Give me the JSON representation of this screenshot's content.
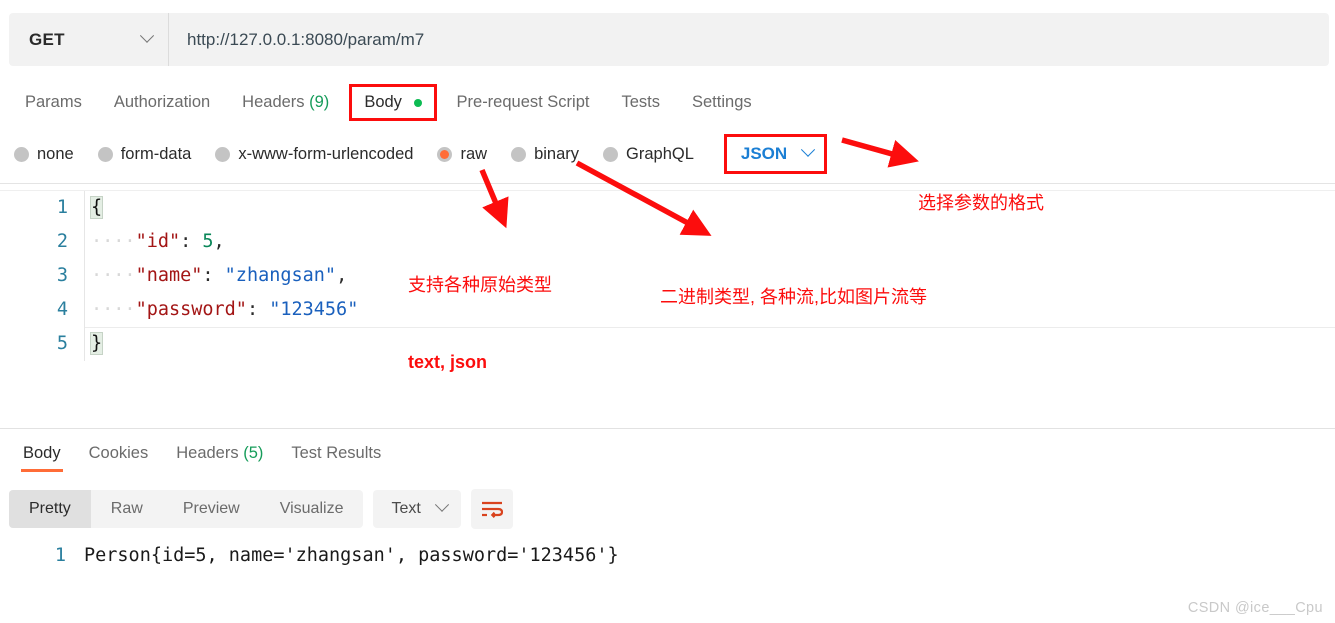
{
  "request": {
    "method": "GET",
    "url": "http://127.0.0.1:8080/param/m7",
    "tabs": [
      {
        "label": "Params"
      },
      {
        "label": "Authorization"
      },
      {
        "label": "Headers",
        "count": "(9)"
      },
      {
        "label": "Body",
        "dot": true,
        "active": true,
        "boxed": true
      },
      {
        "label": "Pre-request Script"
      },
      {
        "label": "Tests"
      },
      {
        "label": "Settings"
      }
    ],
    "body_types": [
      {
        "label": "none",
        "selected": false
      },
      {
        "label": "form-data",
        "selected": false
      },
      {
        "label": "x-www-form-urlencoded",
        "selected": false
      },
      {
        "label": "raw",
        "selected": true
      },
      {
        "label": "binary",
        "selected": false
      },
      {
        "label": "GraphQL",
        "selected": false
      }
    ],
    "format_select": {
      "value": "JSON",
      "icon": "chevron-down-icon"
    }
  },
  "editor": {
    "lines": [
      {
        "num": "1",
        "open_brace": "{"
      },
      {
        "num": "2",
        "indent": "····",
        "key": "\"id\"",
        "colon": ":",
        "space": " ",
        "num_value": "5",
        "comma": ","
      },
      {
        "num": "3",
        "indent": "····",
        "key": "\"name\"",
        "colon": ":",
        "space": " ",
        "str_value": "\"zhangsan\"",
        "comma": ","
      },
      {
        "num": "4",
        "indent": "····",
        "key": "\"password\"",
        "colon": ":",
        "space": " ",
        "str_value": "\"123456\""
      },
      {
        "num": "5",
        "close_brace": "}"
      }
    ]
  },
  "annotations": [
    {
      "id": "raw-note",
      "line1": "支持各种原始类型",
      "line2": "text, json"
    },
    {
      "id": "binary-note",
      "line1": "二进制类型, 各种流,比如图片流等"
    },
    {
      "id": "format-note",
      "line1": "选择参数的格式"
    }
  ],
  "response": {
    "tabs": [
      {
        "label": "Body",
        "active": true
      },
      {
        "label": "Cookies"
      },
      {
        "label": "Headers",
        "count": "(5)"
      },
      {
        "label": "Test Results"
      }
    ],
    "view_modes": [
      {
        "label": "Pretty",
        "active": true
      },
      {
        "label": "Raw"
      },
      {
        "label": "Preview"
      },
      {
        "label": "Visualize"
      }
    ],
    "format_select": {
      "value": "Text",
      "icon": "chevron-down-icon"
    },
    "wrap_button_icon": "word-wrap-icon",
    "body": {
      "line_number": "1",
      "text": "Person{id=5, name='zhangsan', password='123456'}"
    }
  },
  "watermark": "CSDN @ice___Cpu",
  "colors": {
    "accent_orange": "#ff6c37",
    "annotation_red": "#fc0d0d",
    "green_dot": "#0cbb52",
    "json_blue": "#1b7fd4",
    "line_number": "#2a7f9e"
  }
}
